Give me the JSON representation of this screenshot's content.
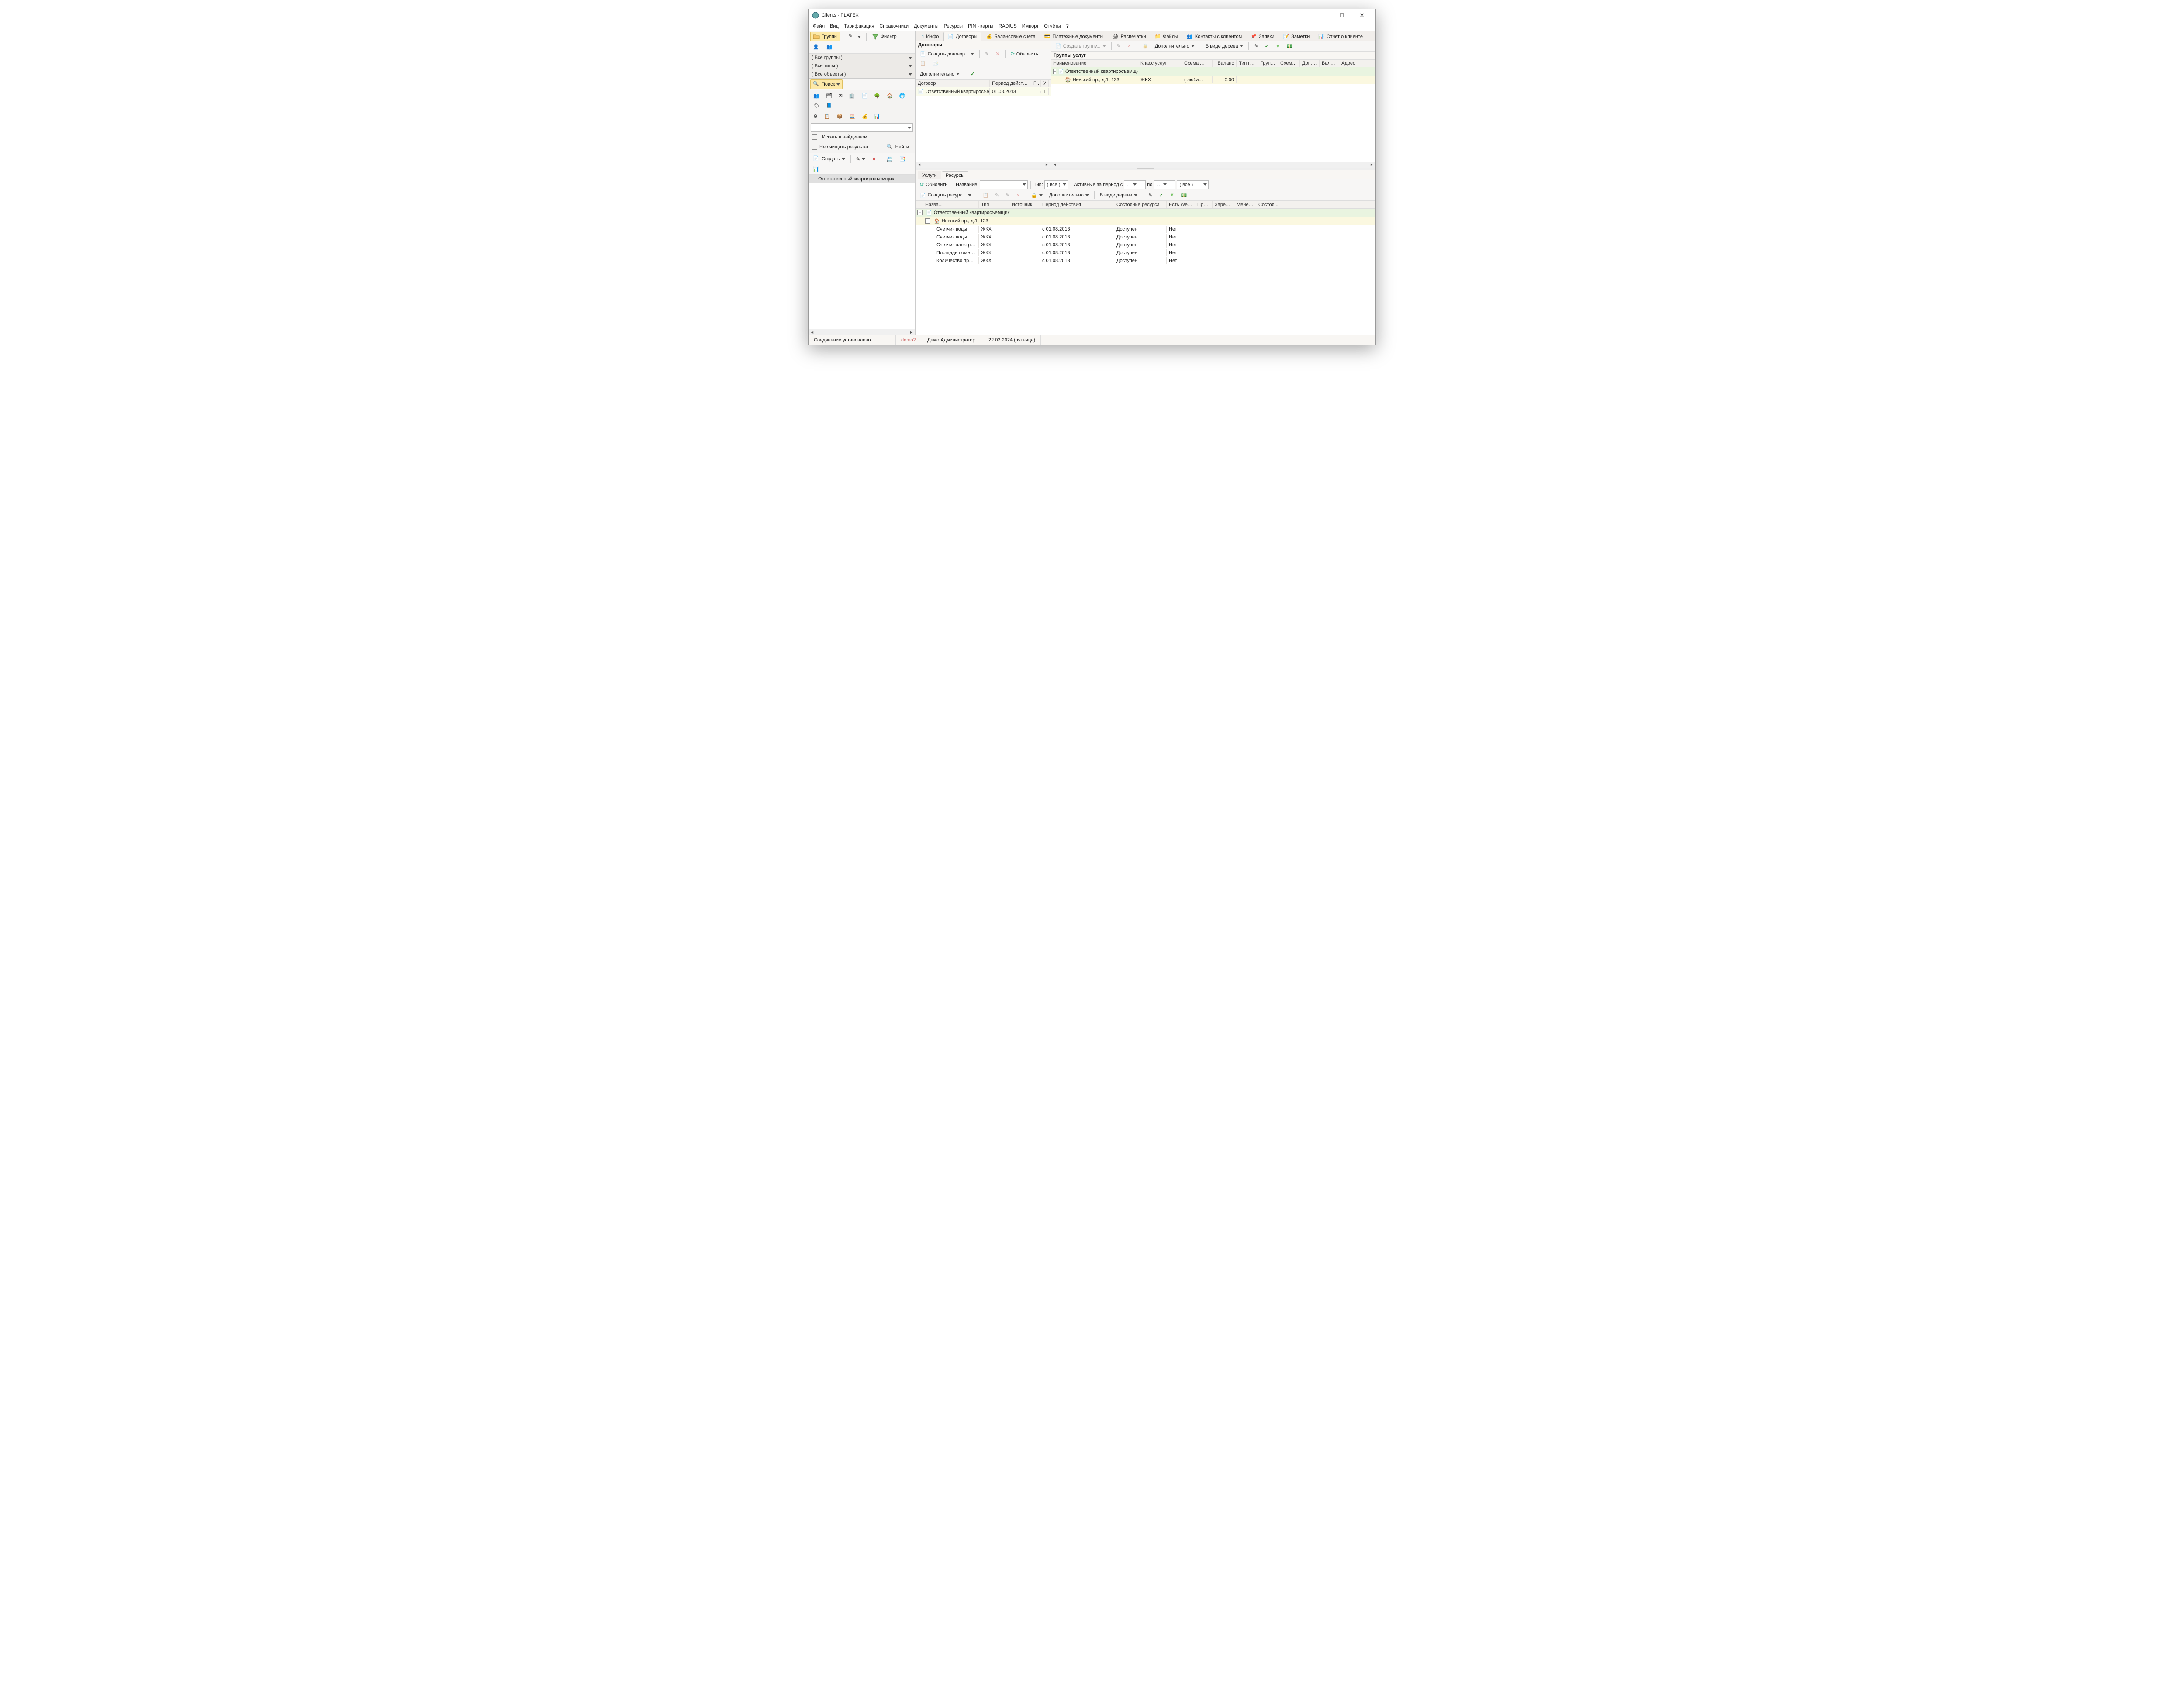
{
  "window": {
    "title": "Clients - PLATEX"
  },
  "menu": {
    "items": [
      "Файл",
      "Вид",
      "Тарификация",
      "Справочники",
      "Документы",
      "Ресурсы",
      "PIN - карты",
      "RADIUS",
      "Импорт",
      "Отчёты",
      "?"
    ]
  },
  "leftToolbar": {
    "groups": "Группы",
    "filter": "Фильтр"
  },
  "leftFilters": {
    "allGroups": "( Все группы )",
    "allTypes": "( Все типы )",
    "allObjects": "( Все объекты )",
    "search": "Поиск"
  },
  "leftSearch": {
    "inFound": "Искать в найденном",
    "keepResult": "Не очищать результат",
    "find": "Найти",
    "create": "Создать"
  },
  "clientList": {
    "item": "Ответственный квартиросъемщик"
  },
  "mainTabs": {
    "items": [
      "Инфо",
      "Договоры",
      "Балансовые счета",
      "Платежные документы",
      "Распечатки",
      "Файлы",
      "Контакты с клиентом",
      "Заявки",
      "Заметки",
      "Отчет о клиенте"
    ]
  },
  "contracts": {
    "header": "Договоры",
    "create": "Создать договор...",
    "refresh": "Обновить",
    "more": "Дополнительно",
    "cols": {
      "contract": "Договор",
      "period": "Период действия",
      "gu": "ГУ",
      "u": "У"
    },
    "row": {
      "name": "Ответственный квартиросъемщик",
      "period": "01.08.2013",
      "gu": "",
      "u": "1"
    }
  },
  "serviceGroups": {
    "header": "Группы услуг",
    "create": "Создать группу...",
    "more": "Дополнительно",
    "tree": "В виде дерева",
    "cols": {
      "name": "Наименование",
      "class": "Класс услуг",
      "scheme": "Схема ...",
      "balance": "Баланс",
      "groupType": "Тип гру...",
      "group": "Групп...",
      "scheme2": "Схема ...",
      "addl": "Доп. п...",
      "balanceDate": "Балан...",
      "address": "Адрес"
    },
    "root": {
      "name": "Ответственный квартиросъемщик"
    },
    "child": {
      "name": "Невский пр., д.1, 123",
      "class": "ЖКХ",
      "scheme": "( люба...",
      "balance": "0.00"
    }
  },
  "bottomTabs": {
    "services": "Услуги",
    "resources": "Ресурсы"
  },
  "resourcesToolbar": {
    "refresh": "Обновить",
    "nameLabel": "Название:",
    "typeLabel": "Тип:",
    "typeAll": "( все )",
    "rangeLabel": "Активные за период с",
    "to": "по",
    "all2": "( все )",
    "createRes": "Создать ресурс...",
    "more": "Дополнительно",
    "tree": "В виде дерева"
  },
  "resCols": {
    "name": "Назва...",
    "type": "Тип",
    "source": "Источник",
    "period": "Период действия",
    "state": "Состояние ресурса",
    "hasWeb": "Есть Web-...",
    "prim": "При...",
    "reserved": "Зарезе...",
    "manager": "Менед...",
    "state2": "Состоя..."
  },
  "resTree": {
    "root": "Ответственный квартиросъемщик",
    "addr": "Невский пр., д.1, 123",
    "rows": [
      {
        "name": "Счетчик воды",
        "type": "ЖКХ",
        "period": "с 01.08.2013",
        "state": "Доступен",
        "hasWeb": "Нет"
      },
      {
        "name": "Счетчик воды",
        "type": "ЖКХ",
        "period": "с 01.08.2013",
        "state": "Доступен",
        "hasWeb": "Нет"
      },
      {
        "name": "Счетчик электроэне...",
        "type": "ЖКХ",
        "period": "с 01.08.2013",
        "state": "Доступен",
        "hasWeb": "Нет"
      },
      {
        "name": "Площадь помещения",
        "type": "ЖКХ",
        "period": "с 01.08.2013",
        "state": "Доступен",
        "hasWeb": "Нет"
      },
      {
        "name": "Количество прожив...",
        "type": "ЖКХ",
        "period": "с 01.08.2013",
        "state": "Доступен",
        "hasWeb": "Нет"
      }
    ]
  },
  "status": {
    "conn": "Соединение установлено",
    "user": "demo2",
    "admin": "Демо Администратор",
    "date": "22.03.2024 (пятница)"
  }
}
